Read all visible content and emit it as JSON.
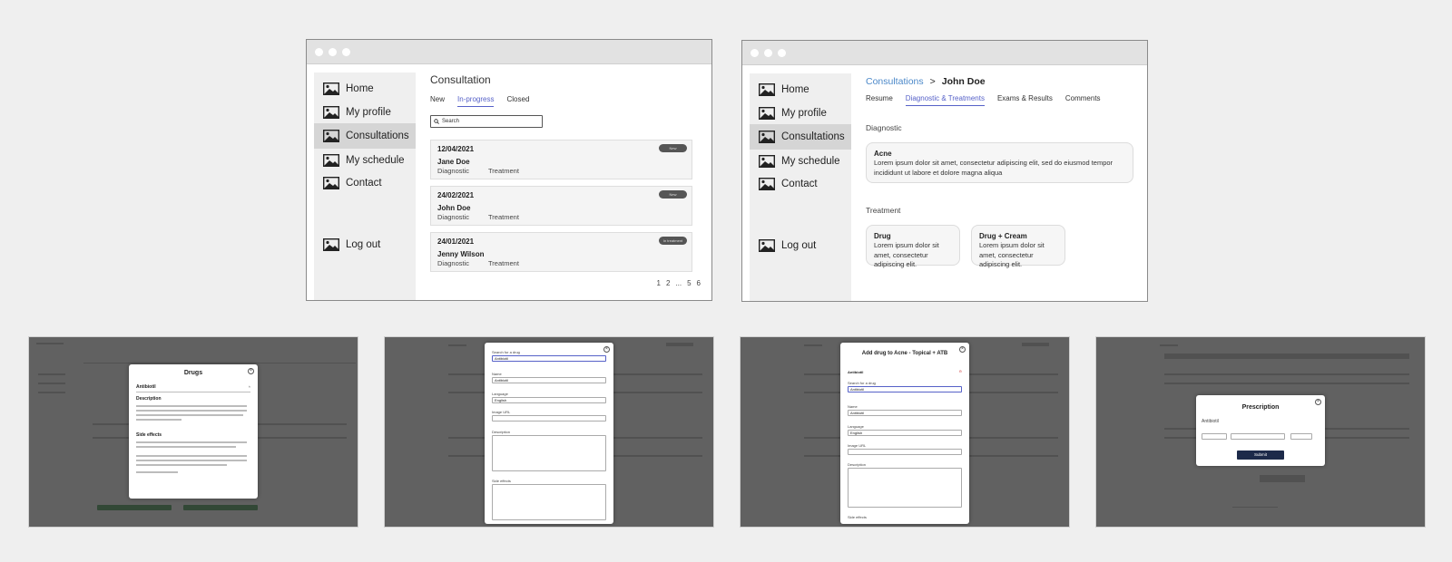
{
  "window1": {
    "nav": [
      {
        "label": "Home",
        "icon": "image-icon"
      },
      {
        "label": "My profile",
        "icon": "image-icon"
      },
      {
        "label": "Consultations",
        "icon": "image-icon",
        "active": true
      },
      {
        "label": "My schedule",
        "icon": "image-icon"
      },
      {
        "label": "Contact",
        "icon": "image-icon"
      }
    ],
    "logout": "Log out",
    "title": "Consultation",
    "tabs": [
      "New",
      "In-progress",
      "Closed"
    ],
    "active_tab": "In-progress",
    "search_placeholder": "Search",
    "consultations": [
      {
        "date": "12/04/2021",
        "name": "Jane Doe",
        "diagnostic": "Diagnostic",
        "treatment": "Treatment",
        "badge": "New"
      },
      {
        "date": "24/02/2021",
        "name": "John Doe",
        "diagnostic": "Diagnostic",
        "treatment": "Treatment",
        "badge": "New"
      },
      {
        "date": "24/01/2021",
        "name": "Jenny Wilson",
        "diagnostic": "Diagnostic",
        "treatment": "Treatment",
        "badge": "In treatment"
      }
    ],
    "pagination": [
      "1",
      "2",
      "...",
      "5",
      "6"
    ]
  },
  "window2": {
    "nav": [
      {
        "label": "Home",
        "icon": "image-icon"
      },
      {
        "label": "My profile",
        "icon": "image-icon"
      },
      {
        "label": "Consultations",
        "icon": "image-icon",
        "active": true
      },
      {
        "label": "My schedule",
        "icon": "image-icon"
      },
      {
        "label": "Contact",
        "icon": "image-icon"
      }
    ],
    "logout": "Log out",
    "breadcrumb": {
      "parent": "Consultations",
      "sep": ">",
      "current": "John Doe"
    },
    "tabs": [
      "Resume",
      "Diagnostic & Treatments",
      "Exams & Results",
      "Comments"
    ],
    "active_tab": "Diagnostic & Treatments",
    "diagnostic_label": "Diagnostic",
    "diagnostic": {
      "title": "Acne",
      "text": "Lorem ipsum dolor sit amet, consectetur adipiscing elit, sed do eiusmod tempor incididunt ut labore et dolore magna aliqua"
    },
    "treatment_label": "Treatment",
    "treatments": [
      {
        "title": "Drug",
        "text": "Lorem ipsum dolor sit amet, consectetur adipiscing elit."
      },
      {
        "title": "Drug + Cream",
        "text": "Lorem ipsum dolor sit amet, consectetur adipiscing elit."
      }
    ]
  },
  "thumbs": {
    "t1": {
      "modal_title": "Drugs",
      "drug": "Antibiotil",
      "description_label": "Description",
      "side_effects_label": "Side effects"
    },
    "t2": {
      "search_label": "Search for a drug",
      "search_value": "Antibiotil",
      "name_label": "Name",
      "name_value": "Antibiotil",
      "language_label": "Language",
      "language_value": "English",
      "image_label": "Image URL",
      "description_label": "Description",
      "side_effects_label": "Side effects"
    },
    "t3": {
      "modal_title": "Add drug to Acne - Topical + ATB",
      "drug": "Antibiotil",
      "search_label": "Search for a drug",
      "search_value": "Antibiotil",
      "name_label": "Name",
      "name_value": "Antibiotil",
      "language_label": "Language",
      "language_value": "English",
      "image_label": "Image URL",
      "description_label": "Description",
      "side_effects_label": "Side effects"
    },
    "t4": {
      "modal_title": "Prescription",
      "drug": "Antibiotil",
      "submit": "Submit"
    }
  },
  "colors": {
    "accent": "#5661c8",
    "link": "#4b88c9",
    "badge": "#555555",
    "submit": "#1d2a4a"
  }
}
